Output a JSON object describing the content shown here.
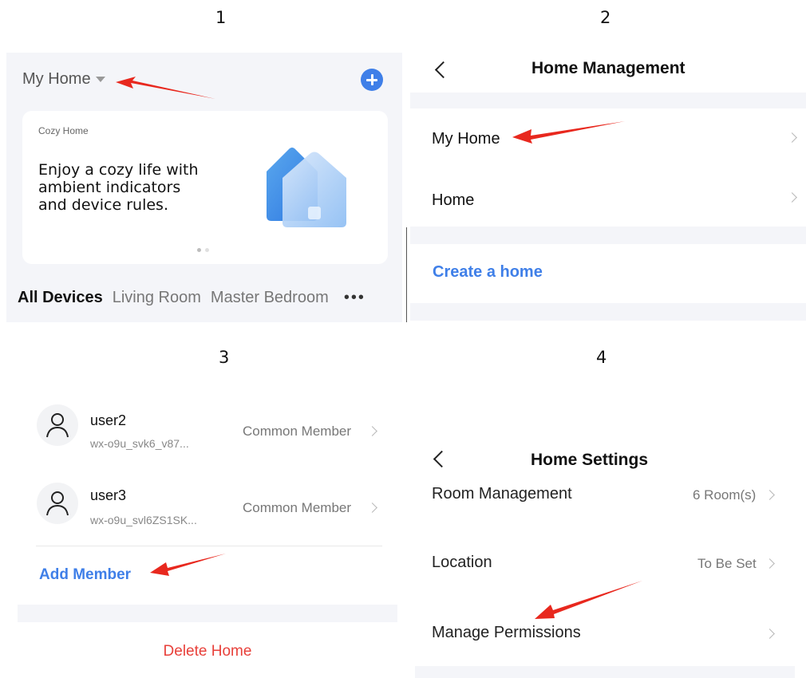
{
  "panel_numbers": [
    "1",
    "2",
    "3",
    "4"
  ],
  "panel1": {
    "home_selector": "My Home",
    "banner": {
      "label": "Cozy Home",
      "headline_lines": [
        "Enjoy a cozy life with",
        "ambient indicators",
        "and device rules."
      ]
    },
    "room_tabs": [
      "All Devices",
      "Living Room",
      "Master Bedroom"
    ],
    "more_icon": "more-dots-icon",
    "add_icon": "plus-circle-icon"
  },
  "panel2": {
    "title": "Home Management",
    "homes": [
      "My Home",
      "Home"
    ],
    "create_home": "Create a home"
  },
  "panel3": {
    "members": [
      {
        "name": "user2",
        "id": "wx-o9u_svk6_v87...",
        "role": "Common Member"
      },
      {
        "name": "user3",
        "id": "wx-o9u_svl6ZS1SK...",
        "role": "Common Member"
      }
    ],
    "add_member": "Add Member",
    "delete_home": "Delete Home"
  },
  "panel4": {
    "title": "Home Settings",
    "rows": [
      {
        "label": "Room Management",
        "value": "6 Room(s)"
      },
      {
        "label": "Location",
        "value": "To Be Set"
      },
      {
        "label": "Manage Permissions",
        "value": ""
      }
    ]
  },
  "colors": {
    "accent_blue": "#3f7fe8",
    "delete_red": "#e8403a",
    "annotation_arrow": "#e8281e",
    "panel_gray": "#f4f5f9"
  }
}
